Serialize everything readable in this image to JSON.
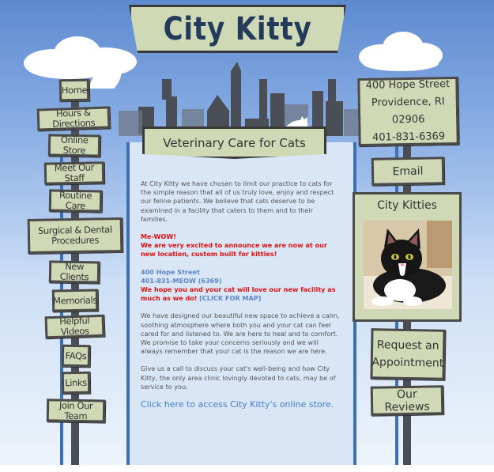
{
  "header": {
    "title": "City Kitty",
    "subtitle": "Veterinary Care for Cats"
  },
  "nav": {
    "items": [
      {
        "label": "Home"
      },
      {
        "label": "Hours & Directions"
      },
      {
        "label": "Online Store"
      },
      {
        "label": "Meet Our Staff"
      },
      {
        "label": "Routine Care"
      },
      {
        "label": "Surgical & Dental Procedures"
      },
      {
        "label": "New Clients"
      },
      {
        "label": "Memorials"
      },
      {
        "label": "Helpful Videos"
      },
      {
        "label": "FAQs"
      },
      {
        "label": "Links"
      },
      {
        "label": "Join Our Team"
      }
    ]
  },
  "contact": {
    "street": "400 Hope Street",
    "city": "Providence, RI 02906",
    "phone": "401-831-6369"
  },
  "right": {
    "email": "Email",
    "kitties_title": "City Kitties",
    "request": "Request an Appointment",
    "reviews": "Our Reviews"
  },
  "content": {
    "intro": "At City Kitty we have chosen to limit our practice to cats for the simple reason that all of us truly love, enjoy and respect our feline patients. We believe that cats deserve to be examined in a facility that caters to them and to their families.",
    "mewow": "Me-WOW!",
    "announce": "We are very excited to announce we are now at our new location, custom built for kitties!",
    "address": "400 Hope Street",
    "phone_meow": "401-831-MEOW (6369)",
    "hope": "We hope you and your cat will love our new facility as much as we do!",
    "map_link": "[CLICK FOR MAP]",
    "designed": "We have designed our beautiful new space to achieve a calm, soothing atmosphere where both you and your cat can feel cared for and listened to. We are here to heal and to comfort. We promise to take your concerns seriously and we will always remember that your cat is the reason we are here.",
    "call": "Give us a call to discuss your cat's well-being and how City Kitty, the only area clinic lovingly devoted to cats, may be of service to you.",
    "store_link": "Click here to access City Kitty's online store."
  },
  "colors": {
    "sign": "#cfd9b6",
    "border": "#4a4a4a",
    "accent_blue": "#3d6fb5",
    "red": "#e01010"
  }
}
